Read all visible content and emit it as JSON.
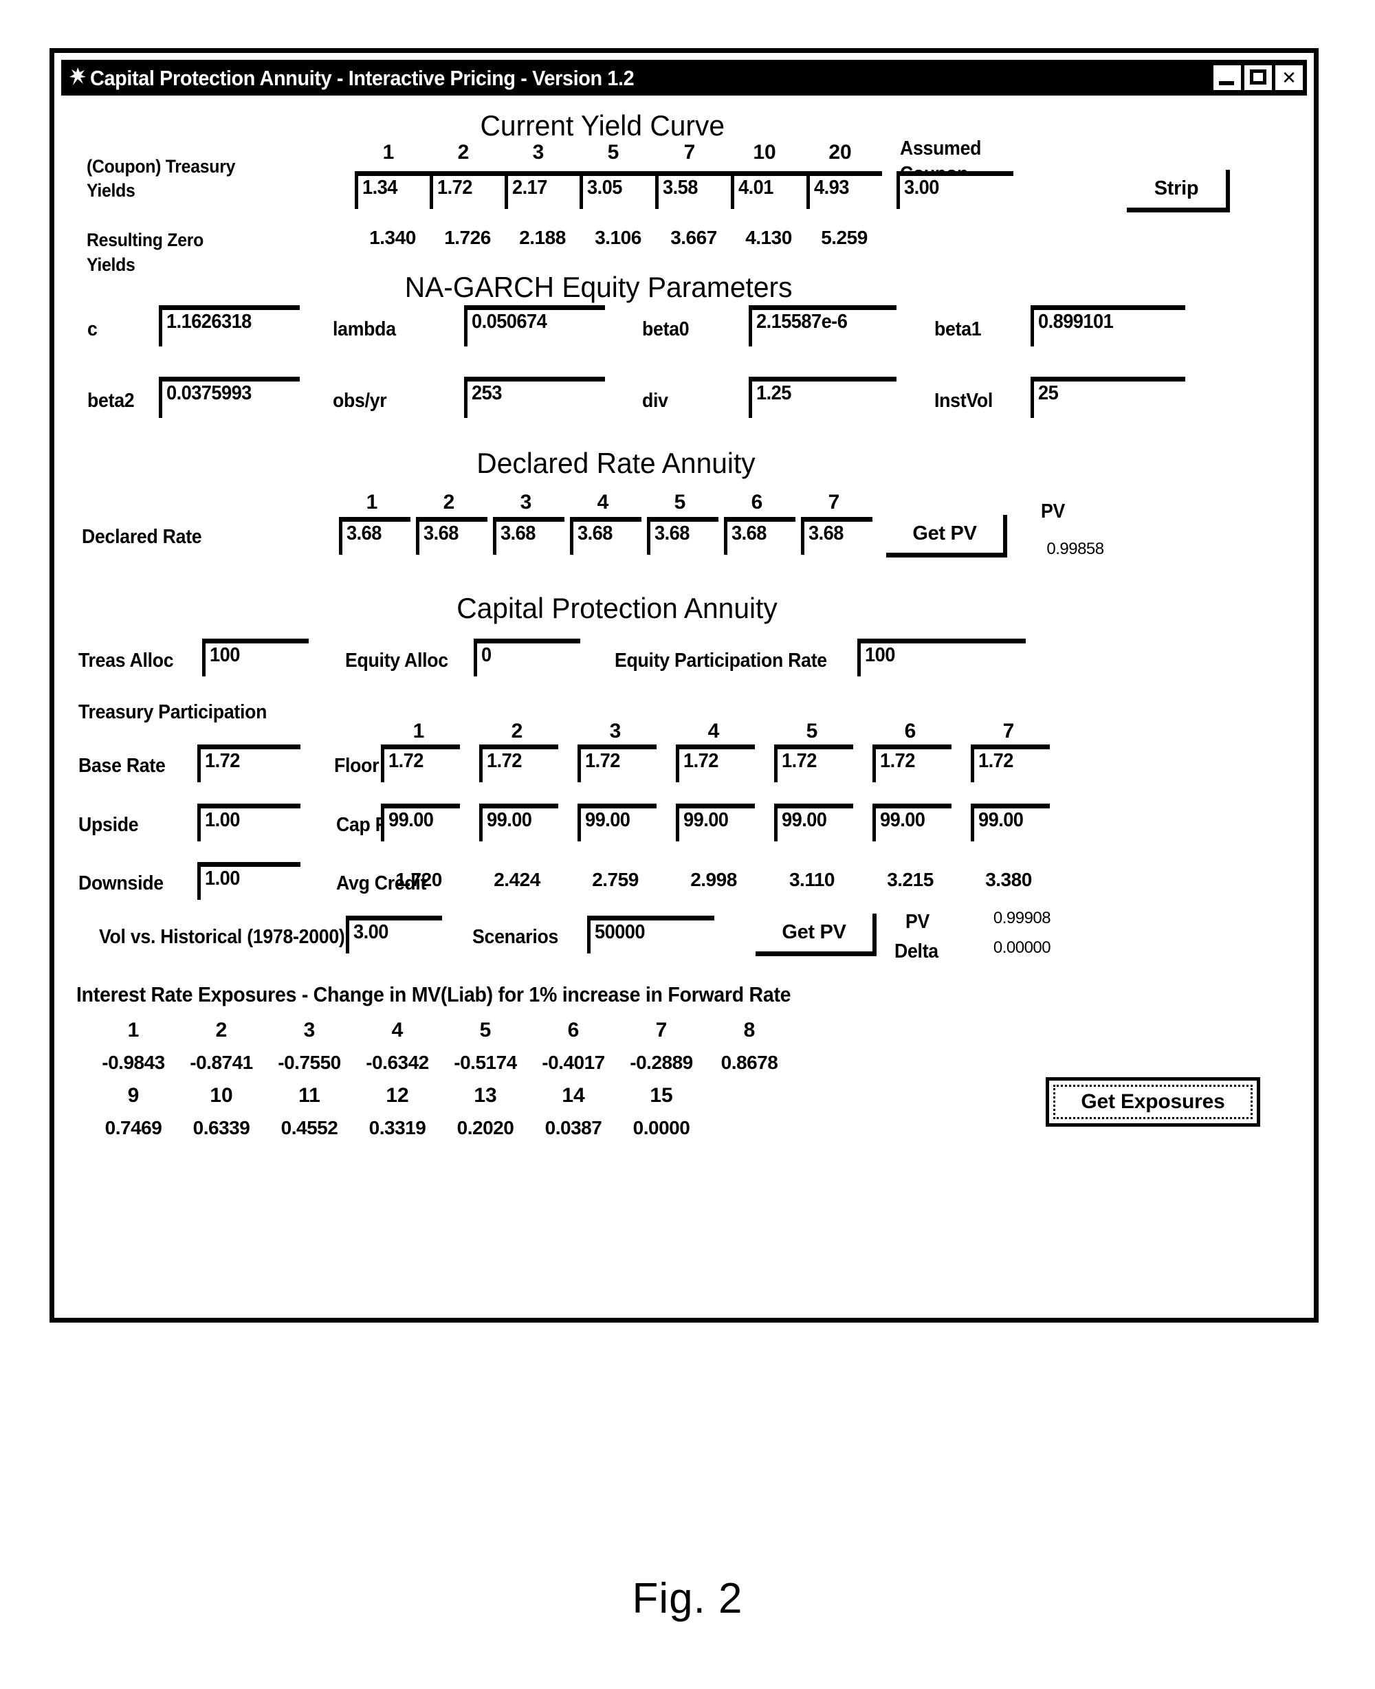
{
  "window": {
    "title": "Capital Protection Annuity - Interactive Pricing - Version 1.2",
    "minimize_label": "_",
    "maximize_label": "□",
    "close_label": "✕"
  },
  "figure": {
    "caption": "Fig. 2"
  },
  "yield_curve": {
    "heading": "Current Yield Curve",
    "coupon_label_line1": "(Coupon) Treasury",
    "coupon_label_line2": "Yields",
    "assumed_label_line1": "Assumed",
    "assumed_label_line2": "Coupon",
    "tenors": [
      "1",
      "2",
      "3",
      "5",
      "7",
      "10",
      "20"
    ],
    "coupon_yields": [
      "1.34",
      "1.72",
      "2.17",
      "3.05",
      "3.58",
      "4.01",
      "4.93"
    ],
    "assumed_coupon": "3.00",
    "strip_button": "Strip",
    "zero_label_line1": "Resulting Zero",
    "zero_label_line2": "Yields",
    "zero_yields": [
      "1.340",
      "1.726",
      "2.188",
      "3.106",
      "3.667",
      "4.130",
      "5.259"
    ]
  },
  "garch": {
    "heading": "NA-GARCH Equity Parameters",
    "row1": [
      {
        "label": "c",
        "value": "1.1626318"
      },
      {
        "label": "lambda",
        "value": "0.050674"
      },
      {
        "label": "beta0",
        "value": "2.15587e-6"
      },
      {
        "label": "beta1",
        "value": "0.899101"
      }
    ],
    "row2": [
      {
        "label": "beta2",
        "value": "0.0375993"
      },
      {
        "label": "obs/yr",
        "value": "253"
      },
      {
        "label": "div",
        "value": "1.25"
      },
      {
        "label": "InstVol",
        "value": "25"
      }
    ]
  },
  "declared_annuity": {
    "heading": "Declared Rate Annuity",
    "row_label": "Declared Rate",
    "columns": [
      "1",
      "2",
      "3",
      "4",
      "5",
      "6",
      "7"
    ],
    "declared_rates": [
      "3.68",
      "3.68",
      "3.68",
      "3.68",
      "3.68",
      "3.68",
      "3.68"
    ],
    "get_pv_button": "Get PV",
    "pv_label": "PV",
    "pv_value": "0.99858"
  },
  "capital_annuity": {
    "heading": "Capital Protection Annuity",
    "treas_alloc_label": "Treas Alloc",
    "treas_alloc_value": "100",
    "equity_alloc_label": "Equity Alloc",
    "equity_alloc_value": "0",
    "equity_participation_label": "Equity Participation Rate",
    "equity_participation_value": "100",
    "treasury_participation_label": "Treasury Participation",
    "columns": [
      "1",
      "2",
      "3",
      "4",
      "5",
      "6",
      "7"
    ],
    "base_rate_label": "Base Rate",
    "base_rate_value": "1.72",
    "floor_rate_label": "Floor Rate",
    "floor_rates": [
      "1.72",
      "1.72",
      "1.72",
      "1.72",
      "1.72",
      "1.72",
      "1.72"
    ],
    "upside_label": "Upside",
    "upside_value": "1.00",
    "cap_rate_label": "Cap Rate",
    "cap_rates": [
      "99.00",
      "99.00",
      "99.00",
      "99.00",
      "99.00",
      "99.00",
      "99.00"
    ],
    "downside_label": "Downside",
    "downside_value": "1.00",
    "avg_credit_label": "Avg Credit",
    "avg_credits": [
      "1.720",
      "2.424",
      "2.759",
      "2.998",
      "3.110",
      "3.215",
      "3.380"
    ],
    "vol_label": "Vol vs. Historical (1978-2000)",
    "vol_value": "3.00",
    "scenarios_label": "Scenarios",
    "scenarios_value": "50000",
    "get_pv_button": "Get PV",
    "pv_label": "PV",
    "pv_value": "0.99908",
    "delta_label": "Delta",
    "delta_value": "0.00000"
  },
  "exposures": {
    "heading": "Interest Rate Exposures - Change in MV(Liab) for 1% increase in Forward Rate",
    "row1_columns": [
      "1",
      "2",
      "3",
      "4",
      "5",
      "6",
      "7",
      "8"
    ],
    "row1_values": [
      "-0.9843",
      "-0.8741",
      "-0.7550",
      "-0.6342",
      "-0.5174",
      "-0.4017",
      "-0.2889",
      "0.8678"
    ],
    "row2_columns": [
      "9",
      "10",
      "11",
      "12",
      "13",
      "14",
      "15"
    ],
    "row2_values": [
      "0.7469",
      "0.6339",
      "0.4552",
      "0.3319",
      "0.2020",
      "0.0387",
      "0.0000"
    ],
    "get_exposures_button": "Get Exposures"
  }
}
